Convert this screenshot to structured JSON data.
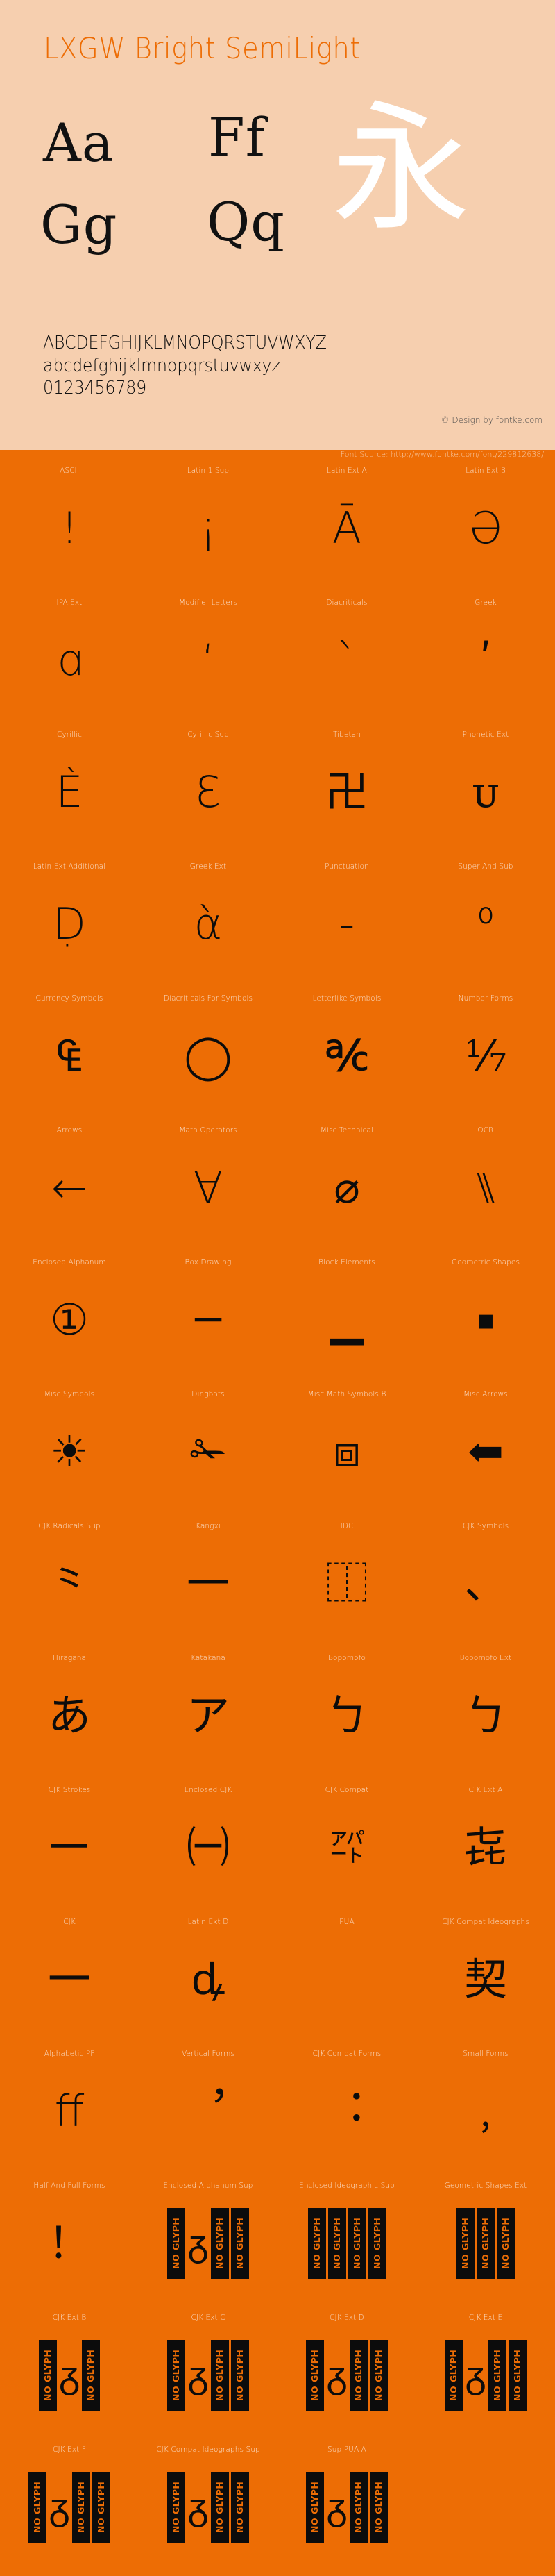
{
  "header": {
    "title": "LXGW Bright SemiLight",
    "accent_color": "#ED6D05",
    "background_color": "#F6CFAF",
    "samples": {
      "pair_1": "Aa",
      "pair_2": "Ff",
      "pair_3": "Gg",
      "pair_4": "Qq",
      "cjk": "永"
    },
    "alphabet_upper": "ABCDEFGHIJKLMNOPQRSTUVWXYZ",
    "alphabet_lower": "abcdefghijklmnopqrstuvwxyz",
    "digits": "0123456789",
    "copyright": "© Design by fontke.com"
  },
  "body": {
    "background_color": "#ED6D05",
    "font_source": "Font Source: http://www.fontke.com/font/229812638/",
    "label_color": "#FBE0CC",
    "glyph_color": "#0C0C0C",
    "no_glyph_text": "NO GLYPH"
  },
  "blocks": [
    {
      "label": "ASCII",
      "glyph": "!",
      "size": "normal",
      "type": "glyph"
    },
    {
      "label": "Latin 1 Sup",
      "glyph": "¡",
      "size": "normal",
      "type": "glyph"
    },
    {
      "label": "Latin Ext A",
      "glyph": "Ā",
      "size": "normal",
      "type": "glyph"
    },
    {
      "label": "Latin Ext B",
      "glyph": "Ə",
      "size": "normal",
      "type": "glyph"
    },
    {
      "label": "IPA Ext",
      "glyph": "ɑ",
      "size": "normal",
      "type": "glyph"
    },
    {
      "label": "Modifier Letters",
      "glyph": "ʻ",
      "size": "normal",
      "type": "glyph"
    },
    {
      "label": "Diacriticals",
      "glyph": "ˋ",
      "size": "normal",
      "type": "glyph"
    },
    {
      "label": "Greek",
      "glyph": "ʹ",
      "size": "normal",
      "type": "glyph"
    },
    {
      "label": "Cyrillic",
      "glyph": "Ѐ",
      "size": "normal",
      "type": "glyph"
    },
    {
      "label": "Cyrillic Sup",
      "glyph": "Ԑ",
      "size": "normal",
      "type": "glyph"
    },
    {
      "label": "Tibetan",
      "glyph": "卍",
      "size": "normal",
      "type": "glyph"
    },
    {
      "label": "Phonetic Ext",
      "glyph": "ᴜ",
      "size": "normal",
      "type": "glyph"
    },
    {
      "label": "Latin Ext Additional",
      "glyph": "Ḍ",
      "size": "normal",
      "type": "glyph"
    },
    {
      "label": "Greek Ext",
      "glyph": "ὰ",
      "size": "normal",
      "type": "glyph"
    },
    {
      "label": "Punctuation",
      "glyph": "‐",
      "size": "normal",
      "type": "glyph"
    },
    {
      "label": "Super And Sub",
      "glyph": "⁰",
      "size": "normal",
      "type": "glyph"
    },
    {
      "label": "Currency Symbols",
      "glyph": "₠",
      "size": "normal",
      "type": "glyph"
    },
    {
      "label": "Diacriticals For Symbols",
      "glyph": "◯",
      "size": "normal",
      "type": "glyph"
    },
    {
      "label": "Letterlike Symbols",
      "glyph": "℀",
      "size": "normal",
      "type": "glyph"
    },
    {
      "label": "Number Forms",
      "glyph": "⅐",
      "size": "normal",
      "type": "glyph"
    },
    {
      "label": "Arrows",
      "glyph": "←",
      "size": "normal",
      "type": "glyph"
    },
    {
      "label": "Math Operators",
      "glyph": "∀",
      "size": "normal",
      "type": "glyph"
    },
    {
      "label": "Misc Technical",
      "glyph": "⌀",
      "size": "normal",
      "type": "glyph"
    },
    {
      "label": "OCR",
      "glyph": "⑊",
      "size": "normal",
      "type": "glyph"
    },
    {
      "label": "Enclosed Alphanum",
      "glyph": "①",
      "size": "normal",
      "type": "glyph"
    },
    {
      "label": "Box Drawing",
      "glyph": "─",
      "size": "normal",
      "type": "glyph"
    },
    {
      "label": "Block Elements",
      "glyph": "▁",
      "size": "normal",
      "type": "glyph"
    },
    {
      "label": "Geometric Shapes",
      "glyph": "▪",
      "size": "tiny",
      "type": "glyph"
    },
    {
      "label": "Misc Symbols",
      "glyph": "☀",
      "size": "normal",
      "type": "glyph"
    },
    {
      "label": "Dingbats",
      "glyph": "✁",
      "size": "normal",
      "type": "glyph"
    },
    {
      "label": "Misc Math Symbols B",
      "glyph": "⧈",
      "size": "normal",
      "type": "glyph"
    },
    {
      "label": "Misc Arrows",
      "glyph": "⬅",
      "size": "normal",
      "type": "glyph"
    },
    {
      "label": "CJK Radicals Sup",
      "glyph": "⺀",
      "size": "normal",
      "type": "glyph"
    },
    {
      "label": "Kangxi",
      "glyph": "⼀",
      "size": "normal",
      "type": "glyph"
    },
    {
      "label": "IDC",
      "glyph": "⿰",
      "size": "normal",
      "type": "glyph"
    },
    {
      "label": "CJK Symbols",
      "glyph": "、",
      "size": "normal",
      "type": "glyph"
    },
    {
      "label": "Hiragana",
      "glyph": "あ",
      "size": "normal",
      "type": "glyph"
    },
    {
      "label": "Katakana",
      "glyph": "ア",
      "size": "normal",
      "type": "glyph"
    },
    {
      "label": "Bopomofo",
      "glyph": "ㄅ",
      "size": "normal",
      "type": "glyph"
    },
    {
      "label": "Bopomofo Ext",
      "glyph": "ㄅ",
      "size": "normal",
      "type": "glyph"
    },
    {
      "label": "CJK Strokes",
      "glyph": "㇐",
      "size": "normal",
      "type": "glyph"
    },
    {
      "label": "Enclosed CJK",
      "glyph": "㈠",
      "size": "normal",
      "type": "glyph"
    },
    {
      "label": "CJK Compat",
      "glyph": "㌀",
      "size": "small",
      "type": "glyph"
    },
    {
      "label": "CJK Ext A",
      "glyph": "㐂",
      "size": "normal",
      "type": "glyph"
    },
    {
      "label": "CJK",
      "glyph": "一",
      "size": "normal",
      "type": "glyph"
    },
    {
      "label": "Latin Ext D",
      "glyph": "ꝱ",
      "size": "normal",
      "type": "glyph"
    },
    {
      "label": "PUA",
      "glyph": "",
      "size": "normal",
      "type": "glyph"
    },
    {
      "label": "CJK Compat Ideographs",
      "glyph": "契",
      "size": "normal",
      "type": "glyph"
    },
    {
      "label": "Alphabetic PF",
      "glyph": "ﬀ",
      "size": "normal",
      "type": "glyph"
    },
    {
      "label": "Vertical Forms",
      "glyph": "︐",
      "size": "normal",
      "type": "glyph"
    },
    {
      "label": "CJK Compat Forms",
      "glyph": "︓",
      "size": "normal",
      "type": "glyph"
    },
    {
      "label": "Small Forms",
      "glyph": "﹐",
      "size": "normal",
      "type": "glyph"
    },
    {
      "label": "Half And Full Forms",
      "glyph": "！",
      "size": "normal",
      "type": "glyph"
    },
    {
      "label": "Enclosed Alphanum Sup",
      "glyph": "",
      "size": "normal",
      "type": "noglyph_mixed",
      "count": 3
    },
    {
      "label": "Enclosed Ideographic Sup",
      "glyph": "",
      "size": "normal",
      "type": "noglyph",
      "count": 4
    },
    {
      "label": "Geometric Shapes Ext",
      "glyph": "",
      "size": "normal",
      "type": "noglyph",
      "count": 3
    },
    {
      "label": "CJK Ext B",
      "glyph": "",
      "size": "normal",
      "type": "noglyph_mixed",
      "count": 2
    },
    {
      "label": "CJK Ext C",
      "glyph": "",
      "size": "normal",
      "type": "noglyph_mixed",
      "count": 3
    },
    {
      "label": "CJK Ext D",
      "glyph": "",
      "size": "normal",
      "type": "noglyph_mixed",
      "count": 3
    },
    {
      "label": "CJK Ext E",
      "glyph": "",
      "size": "normal",
      "type": "noglyph_mixed",
      "count": 3
    },
    {
      "label": "CJK Ext F",
      "glyph": "",
      "size": "normal",
      "type": "noglyph_mixed",
      "count": 3
    },
    {
      "label": "CJK Compat Ideographs Sup",
      "glyph": "",
      "size": "normal",
      "type": "noglyph_mixed",
      "count": 3
    },
    {
      "label": "Sup PUA A",
      "glyph": "",
      "size": "normal",
      "type": "noglyph_mixed",
      "count": 3
    },
    {
      "label": "",
      "glyph": "",
      "size": "normal",
      "type": "empty",
      "count": 0
    }
  ]
}
